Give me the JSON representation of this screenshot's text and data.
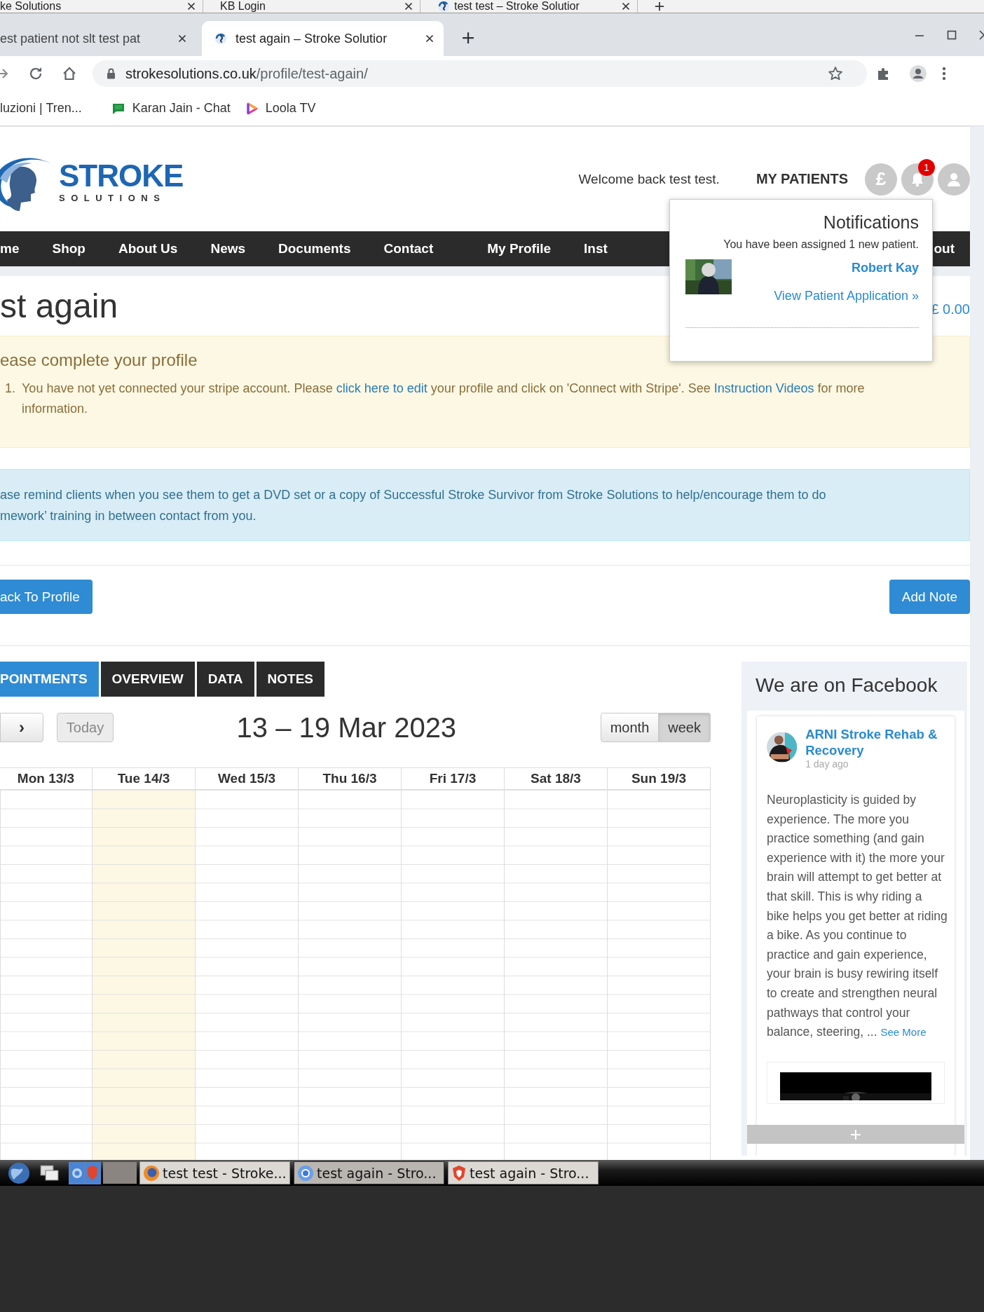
{
  "background_tabs": [
    {
      "title": "ke Solutions",
      "kind": "plain"
    },
    {
      "title": "KB Login",
      "kind": "plain"
    },
    {
      "title": "test test – Stroke Solutior",
      "kind": "site"
    }
  ],
  "browser_tabs": [
    {
      "title": "est patient not slt test pat",
      "selected": false,
      "kind": "plain"
    },
    {
      "title": "test again – Stroke Solutior",
      "selected": true,
      "kind": "site"
    }
  ],
  "address_bar": {
    "domain": "strokesolutions.co.uk",
    "path": "/profile/test-again/"
  },
  "bookmarks": [
    {
      "label": "luzioni | Tren...",
      "kind": "plain"
    },
    {
      "label": "Karan Jain - Chat",
      "kind": "chat"
    },
    {
      "label": "Loola TV",
      "kind": "play"
    }
  ],
  "header": {
    "logo_top": "STROKE",
    "logo_bottom": "SOLUTIONS",
    "welcome": "Welcome back test test.",
    "my_patients": "MY PATIENTS",
    "currency_symbol": "£",
    "notification_count": "1"
  },
  "nav": [
    "me",
    "Shop",
    "About Us",
    "News",
    "Documents",
    "Contact",
    "My Profile",
    "Inst",
    "out"
  ],
  "notifications": {
    "title": "Notifications",
    "message": "You have been assigned 1 new patient.",
    "patient": "Robert Kay",
    "link": "View Patient Application »"
  },
  "page_title": "st again",
  "balance": "£ 0.00",
  "profile_alert": {
    "heading": "ease complete your profile",
    "items": [
      {
        "number": "1.",
        "parts": [
          {
            "kind": "text",
            "text": "You have not yet connected your stripe account. Please "
          },
          {
            "kind": "link",
            "text": "click here to edit"
          },
          {
            "kind": "text",
            "text": " your profile and click on 'Connect with Stripe'. See "
          },
          {
            "kind": "link",
            "text": "Instruction Videos"
          },
          {
            "kind": "text",
            "text": " for more information."
          }
        ]
      }
    ]
  },
  "info_alert": {
    "lines": [
      "ase remind clients when you see them to get a DVD set or a copy of Successful Stroke Survivor from Stroke Solutions to help/encourage them to do",
      "mework’ training in between contact from you."
    ]
  },
  "buttons": {
    "back": "ack To Profile",
    "add_note": "Add Note"
  },
  "tabs": [
    {
      "label": "POINTMENTS",
      "selected": true
    },
    {
      "label": "OVERVIEW",
      "selected": false
    },
    {
      "label": "DATA",
      "selected": false
    },
    {
      "label": "NOTES",
      "selected": false
    }
  ],
  "calendar": {
    "next": "›",
    "today": "Today",
    "title": "13 – 19 Mar 2023",
    "views": [
      {
        "label": "month",
        "selected": false
      },
      {
        "label": "week",
        "selected": true
      }
    ],
    "days": [
      {
        "label": "Mon 13/3",
        "today": false
      },
      {
        "label": "Tue 14/3",
        "today": true
      },
      {
        "label": "Wed 15/3",
        "today": false
      },
      {
        "label": "Thu 16/3",
        "today": false
      },
      {
        "label": "Fri 17/3",
        "today": false
      },
      {
        "label": "Sat 18/3",
        "today": false
      },
      {
        "label": "Sun 19/3",
        "today": false
      }
    ]
  },
  "facebook": {
    "title": "We are on Facebook",
    "page_name": "ARNI Stroke Rehab & Recovery",
    "time": "1 day ago",
    "post": "Neuroplasticity is guided by experience. The more you practice something (and gain experience with it) the more your brain will attempt to get better at that skill. This is why riding a bike helps you get better at riding a bike. As you continue to practice and gain experience, your brain is busy rewiring itself to create and strengthen neural pathways that control your balance, steering, ...",
    "see_more": "See More"
  },
  "taskbar": {
    "windows": [
      {
        "title": "test test - Stroke...",
        "kind": "firefox",
        "selected": false
      },
      {
        "title": "test again - Stro...",
        "kind": "chrome",
        "selected": true
      },
      {
        "title": "test again - Stro...",
        "kind": "brave",
        "selected": false
      }
    ]
  }
}
